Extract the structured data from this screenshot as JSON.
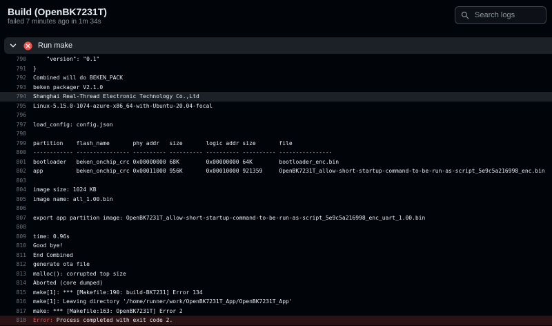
{
  "header": {
    "title": "Build (OpenBK7231T)",
    "subtitle": "failed 7 minutes ago in 1m 34s",
    "search_placeholder": "Search logs"
  },
  "step": {
    "label": "Run make",
    "status": "failed"
  },
  "colors": {
    "error": "#f85149",
    "background": "#010409",
    "step_bg": "#1c2128"
  },
  "log": {
    "lines": [
      {
        "n": "790",
        "t": "    \"version\": \"0.1\""
      },
      {
        "n": "791",
        "t": "}"
      },
      {
        "n": "792",
        "t": "Combined will do BEKEN_PACK"
      },
      {
        "n": "793",
        "t": "beken packager V2.1.0"
      },
      {
        "n": "794",
        "t": "Shanghai Real-Thread Electronic Technology Co.,Ltd"
      },
      {
        "n": "795",
        "t": "Linux-5.15.0-1074-azure-x86_64-with-Ubuntu-20.04-focal"
      },
      {
        "n": "796",
        "t": ""
      },
      {
        "n": "797",
        "t": "load_config: config.json"
      },
      {
        "n": "798",
        "t": ""
      },
      {
        "n": "799",
        "t": "partition    flash_name       phy addr   size       logic addr size       file"
      },
      {
        "n": "800",
        "t": "------------ ---------------- ---------- ---------- ---------- ---------- ----------------"
      },
      {
        "n": "801",
        "t": "bootloader   beken_onchip_crc 0x00000000 68K        0x00000000 64K        bootloader_enc.bin"
      },
      {
        "n": "802",
        "t": "app          beken_onchip_crc 0x00011000 956K       0x00010000 921359     OpenBK7231T_allow-short-startup-command-to-be-run-as-script_5e9c5a216998_enc.bin"
      },
      {
        "n": "803",
        "t": ""
      },
      {
        "n": "804",
        "t": "image size: 1024 KB"
      },
      {
        "n": "805",
        "t": "image name: all_1.00.bin"
      },
      {
        "n": "806",
        "t": ""
      },
      {
        "n": "807",
        "t": "export app partition image: OpenBK7231T_allow-short-startup-command-to-be-run-as-script_5e9c5a216998_enc_uart_1.00.bin"
      },
      {
        "n": "808",
        "t": ""
      },
      {
        "n": "809",
        "t": "time: 0.96s"
      },
      {
        "n": "810",
        "t": "Good bye!"
      },
      {
        "n": "811",
        "t": "End Combined"
      },
      {
        "n": "812",
        "t": "generate ota file"
      },
      {
        "n": "813",
        "t": "malloc(): corrupted top size"
      },
      {
        "n": "814",
        "t": "Aborted (core dumped)"
      },
      {
        "n": "815",
        "t": "make[1]: *** [Makefile:190: build-BK7231] Error 134"
      },
      {
        "n": "816",
        "t": "make[1]: Leaving directory '/home/runner/work/OpenBK7231T_App/OpenBK7231T_App'"
      },
      {
        "n": "817",
        "t": "make: *** [Makefile:163: OpenBK7231T] Error 2"
      },
      {
        "n": "818",
        "err_prefix": "Error:",
        "t": " Process completed with exit code 2."
      }
    ]
  }
}
